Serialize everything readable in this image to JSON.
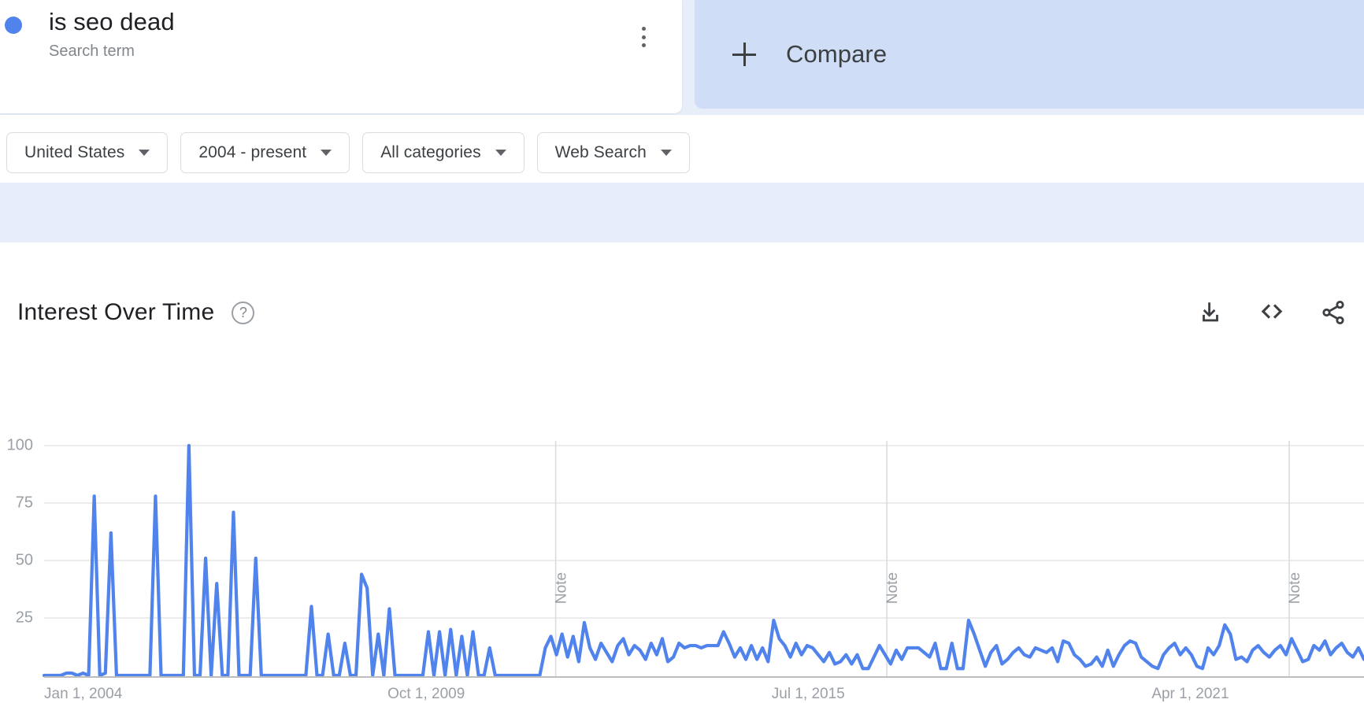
{
  "search_term": {
    "title": "is seo dead",
    "subtype": "Search term",
    "dot_color": "#5183ec",
    "menu_icon": "kebab-menu-icon"
  },
  "compare": {
    "label": "Compare",
    "icon": "plus-icon"
  },
  "filters": [
    {
      "label": "United States",
      "name": "location-filter"
    },
    {
      "label": "2004 - present",
      "name": "time-range-filter"
    },
    {
      "label": "All categories",
      "name": "category-filter"
    },
    {
      "label": "Web Search",
      "name": "search-type-filter"
    }
  ],
  "panel": {
    "title": "Interest Over Time",
    "help_icon": "help-circle-icon",
    "actions": [
      {
        "name": "download-icon",
        "tooltip": "Download"
      },
      {
        "name": "embed-code-icon",
        "tooltip": "Embed"
      },
      {
        "name": "share-icon",
        "tooltip": "Share"
      }
    ]
  },
  "chart_data": {
    "type": "line",
    "title": "Interest Over Time",
    "xlabel": "",
    "ylabel": "",
    "ylim": [
      0,
      100
    ],
    "yticks": [
      25,
      50,
      75,
      100
    ],
    "ytick_labels": [
      "25",
      "50",
      "75",
      "100"
    ],
    "xtick_labels": [
      "Jan 1, 2004",
      "Oct 1, 2009",
      "Jul 1, 2015",
      "Apr 1, 2021"
    ],
    "xtick_positions": [
      0.0,
      0.2895,
      0.5789,
      0.8684
    ],
    "grid": true,
    "legend": false,
    "series_name": "is seo dead",
    "series_color": "#5183ec",
    "annotations": [
      {
        "label": "Note",
        "x_fraction": 0.3876
      },
      {
        "label": "Note",
        "x_fraction": 0.6385
      },
      {
        "label": "Note",
        "x_fraction": 0.9433
      }
    ],
    "x_start": "Jan 1, 2004",
    "x_end": "2024",
    "values": [
      0,
      0,
      0,
      0,
      1,
      1,
      0,
      1,
      0,
      78,
      0,
      1,
      62,
      0,
      0,
      0,
      0,
      0,
      0,
      0,
      78,
      0,
      0,
      0,
      0,
      0,
      100,
      0,
      0,
      51,
      0,
      40,
      0,
      0,
      71,
      0,
      0,
      0,
      51,
      0,
      0,
      0,
      0,
      0,
      0,
      0,
      0,
      0,
      30,
      0,
      0,
      18,
      0,
      0,
      14,
      0,
      0,
      44,
      38,
      0,
      18,
      0,
      29,
      0,
      0,
      0,
      0,
      0,
      0,
      19,
      0,
      19,
      0,
      20,
      0,
      17,
      0,
      19,
      0,
      0,
      12,
      0,
      0,
      0,
      0,
      0,
      0,
      0,
      0,
      0,
      12,
      17,
      9,
      18,
      8,
      17,
      6,
      23,
      12,
      7,
      14,
      10,
      6,
      13,
      16,
      9,
      13,
      11,
      7,
      14,
      9,
      16,
      6,
      8,
      14,
      12,
      13,
      13,
      12,
      13,
      13,
      13,
      19,
      14,
      8,
      12,
      7,
      13,
      7,
      12,
      6,
      24,
      16,
      13,
      8,
      14,
      9,
      13,
      12,
      9,
      6,
      10,
      5,
      6,
      9,
      5,
      9,
      3,
      3,
      8,
      13,
      9,
      5,
      11,
      7,
      12,
      12,
      12,
      10,
      8,
      14,
      3,
      3,
      14,
      3,
      3,
      24,
      18,
      11,
      4,
      10,
      13,
      5,
      7,
      10,
      12,
      9,
      8,
      12,
      11,
      10,
      12,
      6,
      15,
      14,
      9,
      7,
      4,
      5,
      8,
      4,
      11,
      4,
      9,
      13,
      15,
      14,
      8,
      6,
      4,
      3,
      9,
      12,
      14,
      9,
      12,
      9,
      4,
      3,
      12,
      9,
      13,
      22,
      18,
      7,
      8,
      6,
      11,
      13,
      10,
      8,
      11,
      13,
      9,
      16,
      11,
      6,
      7,
      13,
      11,
      15,
      9,
      12,
      14,
      10,
      8,
      12,
      7
    ]
  }
}
